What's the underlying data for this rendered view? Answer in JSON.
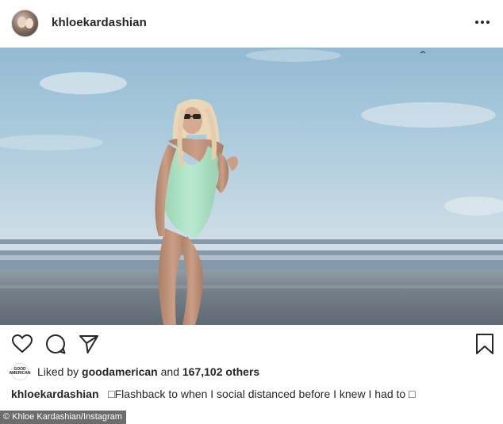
{
  "header": {
    "username": "khloekardashian",
    "more_icon": "more-horizontal-icon"
  },
  "photo": {
    "description_icon": "post-image"
  },
  "actions": {
    "like_icon": "heart-icon",
    "comment_icon": "comment-icon",
    "share_icon": "paper-plane-icon",
    "save_icon": "bookmark-icon"
  },
  "likes": {
    "liker_avatar_text": "GOOD AMERICAN",
    "prefix": "Liked by",
    "liker": "goodamerican",
    "middle": "and",
    "count": "167,102 others"
  },
  "caption": {
    "username": "khloekardashian",
    "text": "□Flashback to when I social distanced before I knew I had to □"
  },
  "credit": "© Khloe Kardashian/Instagram",
  "colors": {
    "text": "#262626",
    "credit_bg": "#6d6d6d",
    "swimsuit": "#a8e0bf"
  }
}
